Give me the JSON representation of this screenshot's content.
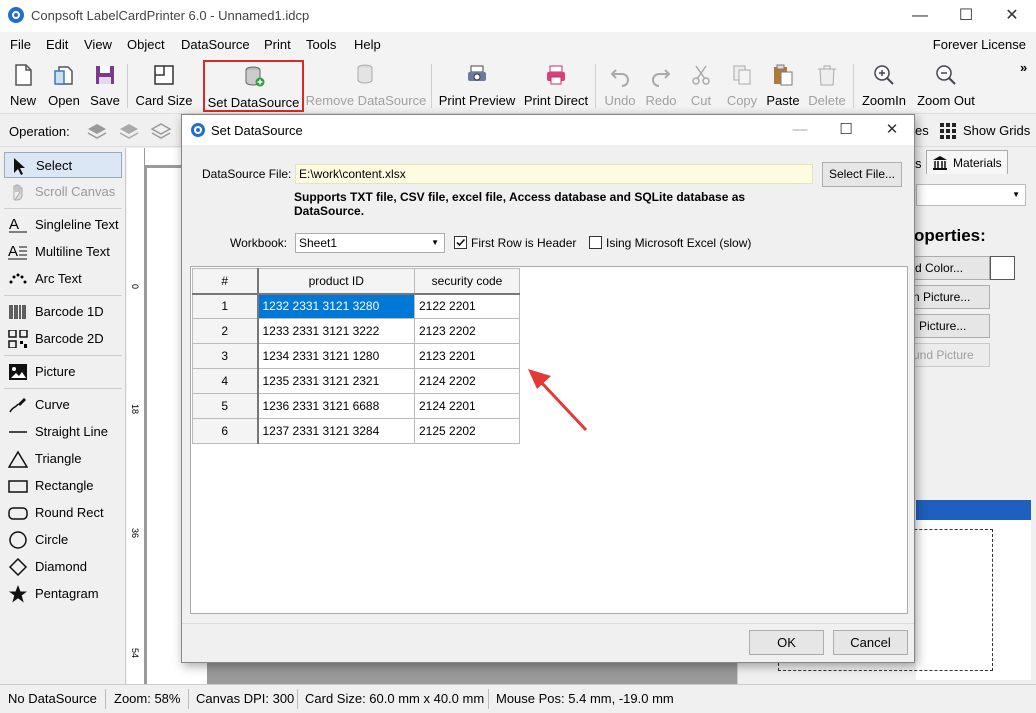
{
  "window": {
    "title": "Conpsoft LabelCardPrinter 6.0 - Unnamed1.idcp",
    "minimize": "—",
    "maximize": "☐",
    "close": "✕"
  },
  "menu": {
    "items": [
      "File",
      "Edit",
      "View",
      "Object",
      "DataSource",
      "Print",
      "Tools",
      "Help"
    ],
    "license": "Forever License"
  },
  "toolbar": {
    "new": "New",
    "open": "Open",
    "save": "Save",
    "card_size": "Card Size",
    "set_datasource": "Set DataSource",
    "remove_datasource": "Remove DataSource",
    "print_preview": "Print Preview",
    "print_direct": "Print Direct",
    "undo": "Undo",
    "redo": "Redo",
    "cut": "Cut",
    "copy": "Copy",
    "paste": "Paste",
    "delete": "Delete",
    "zoom_in": "ZoomIn",
    "zoom_out": "Zoom Out",
    "overflow": "»",
    "highlight_color": "#d92a2a"
  },
  "operation_bar": {
    "label": "Operation:",
    "right_fragment": "es",
    "show_grids": "Show Grids"
  },
  "tools": {
    "select": "Select",
    "scroll_canvas": "Scroll Canvas",
    "singleline_text": "Singleline Text",
    "multiline_text": "Multiline Text",
    "arc_text": "Arc Text",
    "barcode_1d": "Barcode 1D",
    "barcode_2d": "Barcode 2D",
    "picture": "Picture",
    "curve": "Curve",
    "straight_line": "Straight Line",
    "triangle": "Triangle",
    "rectangle": "Rectangle",
    "round_rect": "Round Rect",
    "circle": "Circle",
    "diamond": "Diamond",
    "pentagram": "Pentagram"
  },
  "ruler": {
    "v_marks": [
      "0",
      "18",
      "36",
      "54"
    ]
  },
  "right_panel": {
    "tab_fragment": "s",
    "materials_tab": "Materials",
    "properties_heading": "operties:",
    "btn_color": "d Color...",
    "btn_picture1": "n Picture...",
    "btn_picture2": "Picture...",
    "btn_picture3": "und Picture",
    "accent_color": "#1f5fbf"
  },
  "status": {
    "datasource": "No DataSource",
    "zoom": "Zoom: 58%",
    "dpi": "Canvas DPI: 300",
    "card_size": "Card Size: 60.0 mm x 40.0 mm",
    "mouse_pos": "Mouse Pos: 5.4 mm, -19.0 mm"
  },
  "dialog": {
    "title": "Set DataSource",
    "minimize": "—",
    "maximize": "☐",
    "close": "✕",
    "datasource_file_label": "DataSource File:",
    "datasource_file_value": "E:\\work\\content.xlsx",
    "select_file_button": "Select File...",
    "support_note": "Supports TXT file, CSV file, excel file, Access database and SQLite database as DataSource.",
    "workbook_label": "Workbook:",
    "workbook_value": "Sheet1",
    "first_row_header_label": "First Row is Header",
    "first_row_header_checked": true,
    "using_excel_label": "Ising Microsoft Excel (slow)",
    "using_excel_checked": false,
    "grid": {
      "corner": "#",
      "columns": [
        "product ID",
        "security code"
      ],
      "rows": [
        {
          "num": "1",
          "product_id": "1232 2331 3121 3280",
          "security_code": "2122 2201"
        },
        {
          "num": "2",
          "product_id": "1233 2331 3121 3222",
          "security_code": "2123 2202"
        },
        {
          "num": "3",
          "product_id": "1234 2331 3121 1280",
          "security_code": "2123 2201"
        },
        {
          "num": "4",
          "product_id": "1235 2331 3121 2321",
          "security_code": "2124 2202"
        },
        {
          "num": "5",
          "product_id": "1236 2331 3121 6688",
          "security_code": "2124 2201"
        },
        {
          "num": "6",
          "product_id": "1237 2331 3121 3284",
          "security_code": "2125 2202"
        }
      ]
    },
    "ok_button": "OK",
    "cancel_button": "Cancel",
    "selection_color": "#0078d7",
    "annotation_arrow_color": "#e53935"
  }
}
